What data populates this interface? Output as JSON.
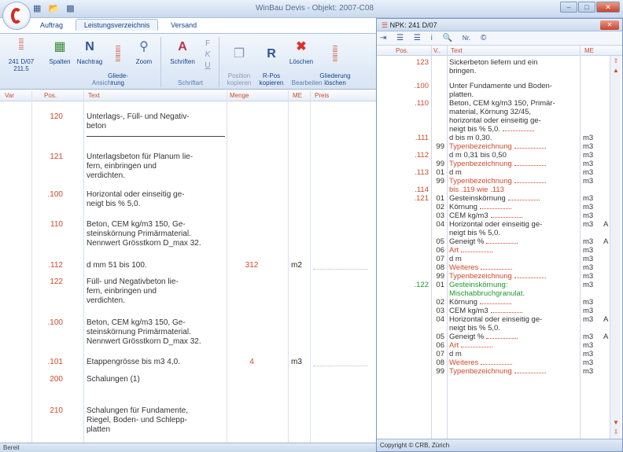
{
  "window": {
    "title": "WinBau Devis - Objekt: 2007-C08",
    "quick_access_icons": [
      "save-icon",
      "folder-icon",
      "disk-icon"
    ],
    "controls": [
      "minimize",
      "maximize",
      "close"
    ]
  },
  "tabs": [
    {
      "label": "Auftrag",
      "active": false
    },
    {
      "label": "Leistungsverzeichnis",
      "active": true
    },
    {
      "label": "Versand",
      "active": false
    }
  ],
  "ribbon": {
    "groups": {
      "ansicht": "Ansicht",
      "schriftart": "Schriftart",
      "bearbeiten": "Bearbeiten"
    },
    "buttons": {
      "npk": "241 D/07 211.5",
      "spalten": "Spalten",
      "nachtrag": "Nachtrag",
      "gliederung": "Gliede-\nrung",
      "zoom": "Zoom",
      "schriften": "Schriften",
      "position_kopieren": "Position\nkopieren",
      "rpos_kopieren": "R-Pos\nkopieren",
      "loeschen": "Löschen",
      "gliederung_loeschen": "Gliederung\nlöschen"
    }
  },
  "table": {
    "columns": {
      "var": "Var",
      "pos": "Pos.",
      "text": "Text",
      "menge": "Menge",
      "me": "ME",
      "preis": "Preis"
    },
    "rows": [
      {
        "num": "120",
        "text": "Unterlags-, Füll- und Negativ-\nbeton",
        "qty": "",
        "unit": ""
      },
      {
        "num": "121",
        "text": "Unterlagsbeton für Planum lie-\nfern, einbringen und\nverdichten.",
        "qty": "",
        "unit": ""
      },
      {
        "num": ".100",
        "text": "Horizontal oder einseitig ge-\nneigt bis % 5,0.",
        "qty": "",
        "unit": ""
      },
      {
        "num": "110",
        "text": "Beton, CEM kg/m3 150, Ge-\nsteinskörnung Primärmaterial.\nNennwert Grösstkorn D_max 32.",
        "qty": "",
        "unit": ""
      },
      {
        "num": ".112",
        "text": "d mm 51 bis 100.",
        "qty": "312",
        "unit": "m2"
      },
      {
        "num": "122",
        "text": "Füll- und Negativbeton lie-\nfern, einbringen und\nverdichten.",
        "qty": "",
        "unit": ""
      },
      {
        "num": ".100",
        "text": "Beton, CEM kg/m3 150, Ge-\nsteinskörnung Primärmaterial.\nNennwert Grösstkorn D_max 32.",
        "qty": "",
        "unit": ""
      },
      {
        "num": ".101",
        "text": "Etappengrösse bis m3 4,0.",
        "qty": "4",
        "unit": "m3"
      },
      {
        "num": "200",
        "text": "Schalungen (1)",
        "qty": "",
        "unit": ""
      },
      {
        "num": "210",
        "text": "Schalungen für Fundamente,\nRiegel, Boden- und Schlepp-\nplatten",
        "qty": "",
        "unit": ""
      }
    ]
  },
  "status": "Bereit",
  "npk_panel": {
    "title": "NPK: 241 D/07",
    "columns": {
      "pos": "Pos.",
      "v": "V..",
      "text": "Text",
      "me": "ME"
    },
    "rows": [
      {
        "pos": "123",
        "v": "",
        "text": "Sickerbeton liefern und ein\nbringen.",
        "me": "",
        "a": "",
        "style": ""
      },
      {
        "pos": ".100",
        "v": "",
        "text": "Unter Fundamente und Boden-\nplatten.",
        "me": "",
        "a": "",
        "style": ""
      },
      {
        "pos": ".110",
        "v": "",
        "text": "Beton, CEM kg/m3 150, Primär-\nmaterial, Körnung 32/45,\nhorizontal oder einseitig ge-\nneigt bis % 5,0.",
        "me": "",
        "a": "",
        "style": ""
      },
      {
        "pos": ".111",
        "v": "",
        "text": "d bis m 0,30.",
        "me": "m3",
        "a": "",
        "style": ""
      },
      {
        "pos": "",
        "v": "99",
        "text": "Typenbezeichnung",
        "me": "m3",
        "a": "",
        "style": "r"
      },
      {
        "pos": ".112",
        "v": "",
        "text": "d m 0,31 bis 0,50",
        "me": "m3",
        "a": "",
        "style": ""
      },
      {
        "pos": "",
        "v": "99",
        "text": "Typenbezeichnung",
        "me": "m3",
        "a": "",
        "style": "r"
      },
      {
        "pos": ".113",
        "v": "01",
        "text": "d m",
        "me": "m3",
        "a": "",
        "style": ""
      },
      {
        "pos": "",
        "v": "99",
        "text": "Typenbezeichnung",
        "me": "m3",
        "a": "",
        "style": "r"
      },
      {
        "pos": ".114",
        "v": "",
        "text": "bis .119 wie .113",
        "me": "",
        "a": "",
        "style": "r"
      },
      {
        "pos": ".121",
        "v": "01",
        "text": "Gesteinskörnung",
        "me": "m3",
        "a": "",
        "style": ""
      },
      {
        "pos": "",
        "v": "02",
        "text": "Körnung",
        "me": "m3",
        "a": "",
        "style": ""
      },
      {
        "pos": "",
        "v": "03",
        "text": "CEM kg/m3",
        "me": "m3",
        "a": "",
        "style": ""
      },
      {
        "pos": "",
        "v": "04",
        "text": "Horizontal oder einseitig ge-\nneigt bis % 5,0.",
        "me": "m3",
        "a": "A",
        "style": ""
      },
      {
        "pos": "",
        "v": "05",
        "text": "Geneigt %",
        "me": "m3",
        "a": "A",
        "style": ""
      },
      {
        "pos": "",
        "v": "06",
        "text": "Art",
        "me": "m3",
        "a": "",
        "style": "r"
      },
      {
        "pos": "",
        "v": "07",
        "text": "d m",
        "me": "m3",
        "a": "",
        "style": ""
      },
      {
        "pos": "",
        "v": "08",
        "text": "Weiteres",
        "me": "m3",
        "a": "",
        "style": "r"
      },
      {
        "pos": "",
        "v": "99",
        "text": "Typenbezeichnung",
        "me": "m3",
        "a": "",
        "style": "r"
      },
      {
        "pos": ".122",
        "v": "01",
        "text": "Gesteinskörnung:\nMischabbruchgranulat.",
        "me": "m3",
        "a": "",
        "style": "g"
      },
      {
        "pos": "",
        "v": "02",
        "text": "Körnung",
        "me": "m3",
        "a": "",
        "style": ""
      },
      {
        "pos": "",
        "v": "03",
        "text": "CEM kg/m3",
        "me": "m3",
        "a": "",
        "style": ""
      },
      {
        "pos": "",
        "v": "04",
        "text": "Horizontal oder einseitig ge-\nneigt bis % 5,0.",
        "me": "m3",
        "a": "A",
        "style": ""
      },
      {
        "pos": "",
        "v": "05",
        "text": "Geneigt %",
        "me": "m3",
        "a": "A",
        "style": ""
      },
      {
        "pos": "",
        "v": "06",
        "text": "Art",
        "me": "m3",
        "a": "",
        "style": "r"
      },
      {
        "pos": "",
        "v": "07",
        "text": "d m",
        "me": "m3",
        "a": "",
        "style": ""
      },
      {
        "pos": "",
        "v": "08",
        "text": "Weiteres",
        "me": "m3",
        "a": "",
        "style": "r"
      },
      {
        "pos": "",
        "v": "99",
        "text": "Typenbezeichnung",
        "me": "m3",
        "a": "",
        "style": "r"
      }
    ],
    "footer": "Copyright © CRB, Zürich"
  },
  "colors": {
    "position_red": "#d04a2c",
    "variant_green": "#1e9a2c",
    "ribbon_blue": "#15428b"
  }
}
